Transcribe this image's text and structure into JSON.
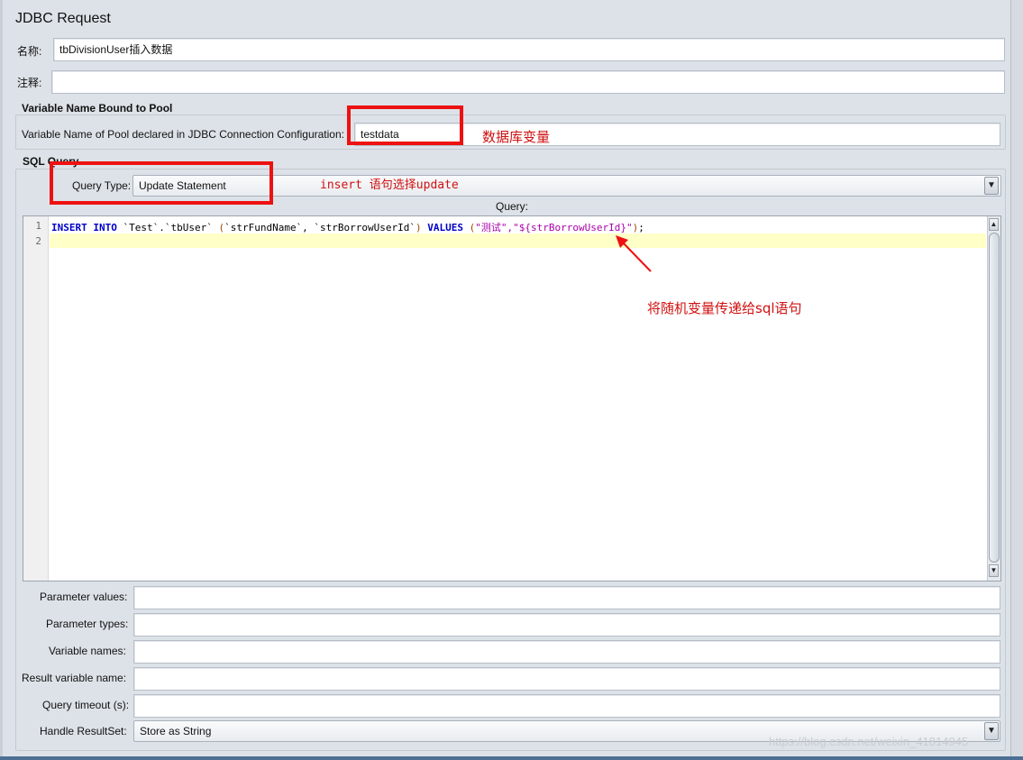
{
  "window": {
    "title": "JDBC Request"
  },
  "fields": {
    "name_label": "名称:",
    "name_value": "tbDivisionUser插入数据",
    "comment_label": "注释:",
    "comment_value": ""
  },
  "pool_group": {
    "title": "Variable Name Bound to Pool",
    "label": "Variable Name of Pool declared in JDBC Connection Configuration:",
    "value": "testdata"
  },
  "sql_group": {
    "title": "SQL Query",
    "query_type_label": "Query Type:",
    "query_type_value": "Update Statement",
    "query_label": "Query:"
  },
  "editor": {
    "line_numbers": [
      "1",
      "2"
    ],
    "line1_tokens": [
      {
        "t": "INSERT",
        "c": "kw"
      },
      {
        "t": " ",
        "c": ""
      },
      {
        "t": "INTO",
        "c": "kw"
      },
      {
        "t": " `Test`.`tbUser` ",
        "c": ""
      },
      {
        "t": "(",
        "c": "paren"
      },
      {
        "t": "`strFundName`, `strBorrowUserId`",
        "c": ""
      },
      {
        "t": ")",
        "c": "paren"
      },
      {
        "t": " ",
        "c": ""
      },
      {
        "t": "VALUES",
        "c": "kw"
      },
      {
        "t": " ",
        "c": ""
      },
      {
        "t": "(",
        "c": "paren"
      },
      {
        "t": "\"测试\",\"${strBorrowUserId}\"",
        "c": "str"
      },
      {
        "t": ")",
        "c": "paren"
      },
      {
        "t": ";",
        "c": ""
      }
    ]
  },
  "params": [
    {
      "label": "Parameter values:",
      "value": ""
    },
    {
      "label": "Parameter types:",
      "value": ""
    },
    {
      "label": "Variable names:",
      "value": ""
    },
    {
      "label": "Result variable name:",
      "value": ""
    },
    {
      "label": "Query timeout (s):",
      "value": ""
    }
  ],
  "handle_resultset": {
    "label": "Handle ResultSet:",
    "value": "Store as String"
  },
  "annotations": {
    "db_variable": "数据库变量",
    "insert_note": "insert 语句选择update",
    "random_var_note": "将随机变量传递给sql语句"
  },
  "watermark": "https://blog.csdn.net/weixin_41814945",
  "colors": {
    "annotation_red": "#ee1111",
    "keyword_blue": "#0000c8",
    "string_magenta": "#a900a9",
    "highlight_line": "#ffffc8"
  },
  "icons": {
    "combo_arrow": "triangle-down",
    "scroll_up": "triangle-up",
    "scroll_down": "triangle-down"
  }
}
